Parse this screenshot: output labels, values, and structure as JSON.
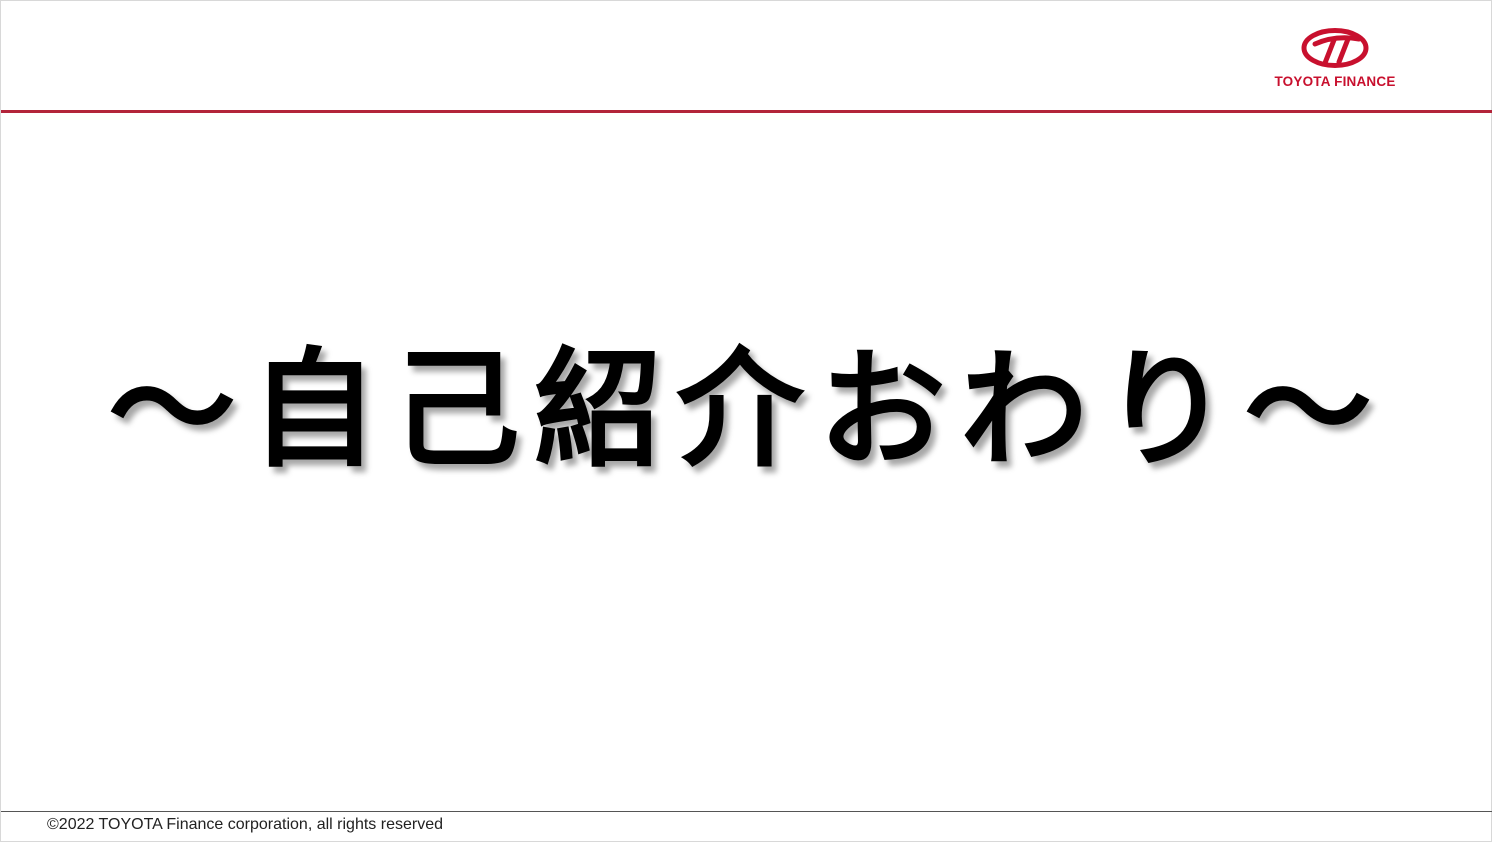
{
  "header": {
    "logo_text": "TOYOTA FINANCE",
    "logo_icon": "toyota-finance-emblem-icon",
    "rule_color": "#b3243a",
    "brand_color": "#c8102e"
  },
  "main": {
    "title": "～自己紹介おわり～"
  },
  "footer": {
    "copyright": "©2022 TOYOTA Finance corporation, all rights reserved"
  }
}
